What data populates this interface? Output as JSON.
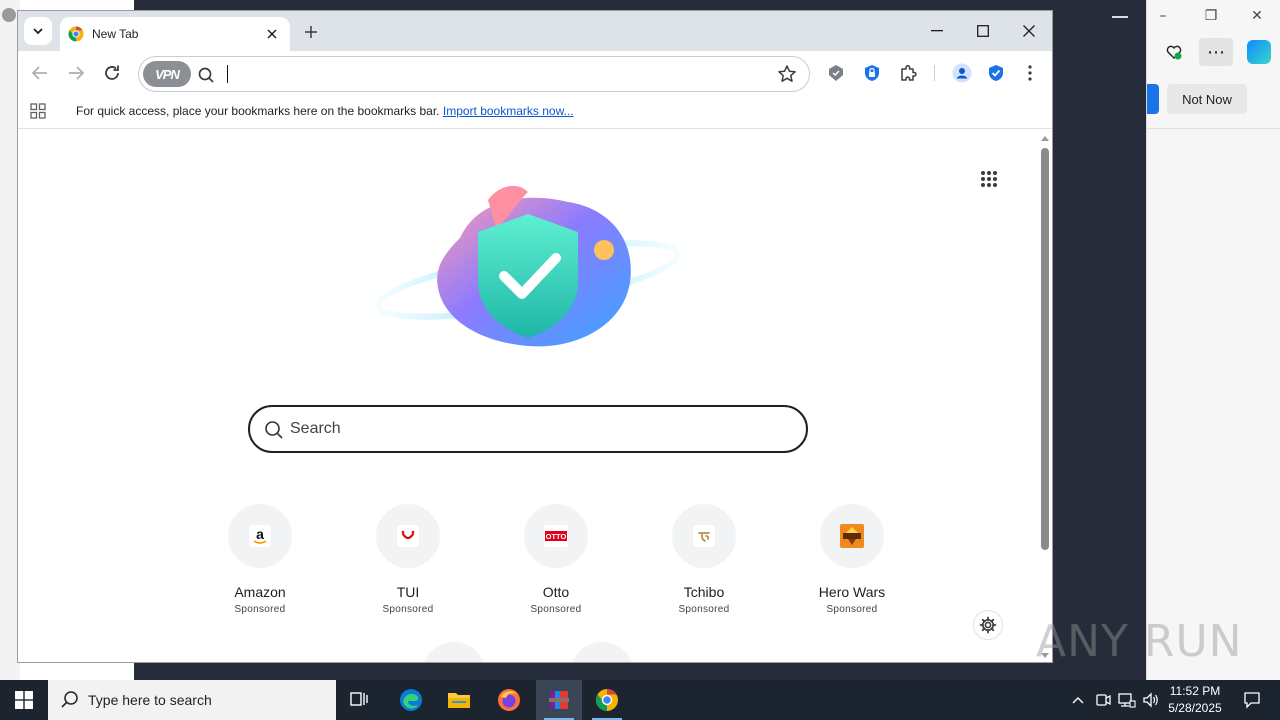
{
  "browser": {
    "tab_title": "New Tab",
    "vpn_label": "VPN",
    "address_placeholder": "",
    "bookmarks_message": "For quick access, place your bookmarks here on the bookmarks bar.",
    "bookmarks_link": "Import bookmarks now..."
  },
  "newtab": {
    "search_placeholder": "Search",
    "tiles": [
      {
        "name": "Amazon",
        "label": "Sponsored",
        "icon": "amazon-logo"
      },
      {
        "name": "TUI",
        "label": "Sponsored",
        "icon": "tui-logo"
      },
      {
        "name": "Otto",
        "label": "Sponsored",
        "icon": "otto-logo"
      },
      {
        "name": "Tchibo",
        "label": "Sponsored",
        "icon": "tchibo-logo"
      },
      {
        "name": "Hero Wars",
        "label": "Sponsored",
        "icon": "hero-wars-logo"
      }
    ],
    "otto_logo_text": "OTTO"
  },
  "edge_background": {
    "not_now_label": "Not Now"
  },
  "taskbar": {
    "search_placeholder": "Type here to search",
    "time": "11:52 PM",
    "date": "5/28/2025"
  },
  "watermark": {
    "text": "ANY RUN"
  },
  "colors": {
    "accent_blue": "#1a73e8",
    "taskbar": "#1c2430",
    "dark_backdrop": "#272c3a"
  }
}
